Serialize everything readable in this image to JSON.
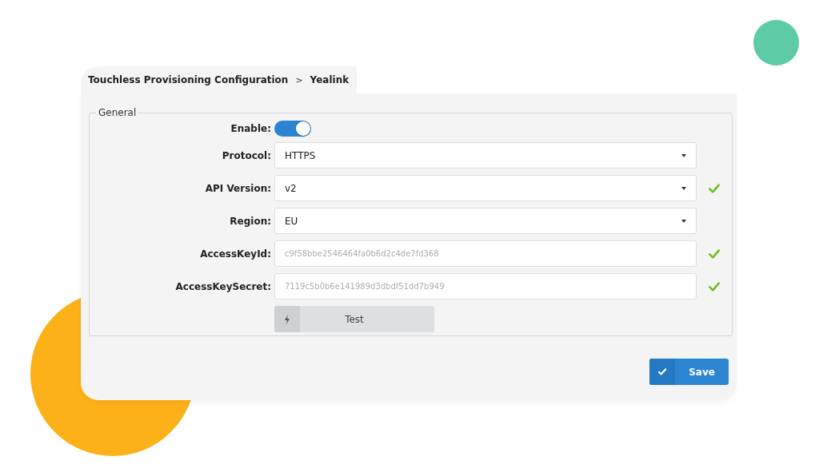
{
  "breadcrumb": {
    "items": [
      "Touchless Provisioning Configuration",
      "Yealink"
    ],
    "separator": ">"
  },
  "section": {
    "legend": "General",
    "fields": [
      {
        "kind": "toggle",
        "label": "Enable:",
        "on": true
      },
      {
        "kind": "select",
        "label": "Protocol:",
        "value": "HTTPS",
        "verified": false
      },
      {
        "kind": "select",
        "label": "API Version:",
        "value": "v2",
        "verified": true
      },
      {
        "kind": "select",
        "label": "Region:",
        "value": "EU",
        "verified": false
      },
      {
        "kind": "text",
        "label": "AccessKeyId:",
        "value": "c9f58bbe2546464fa0b6d2c4de7fd368",
        "verified": true
      },
      {
        "kind": "text",
        "label": "AccessKeySecret:",
        "value": "7119c5b0b6e141989d3dbdf51dd7b949",
        "verified": true
      }
    ],
    "test_button": {
      "label": "Test"
    }
  },
  "save_button": {
    "label": "Save"
  }
}
